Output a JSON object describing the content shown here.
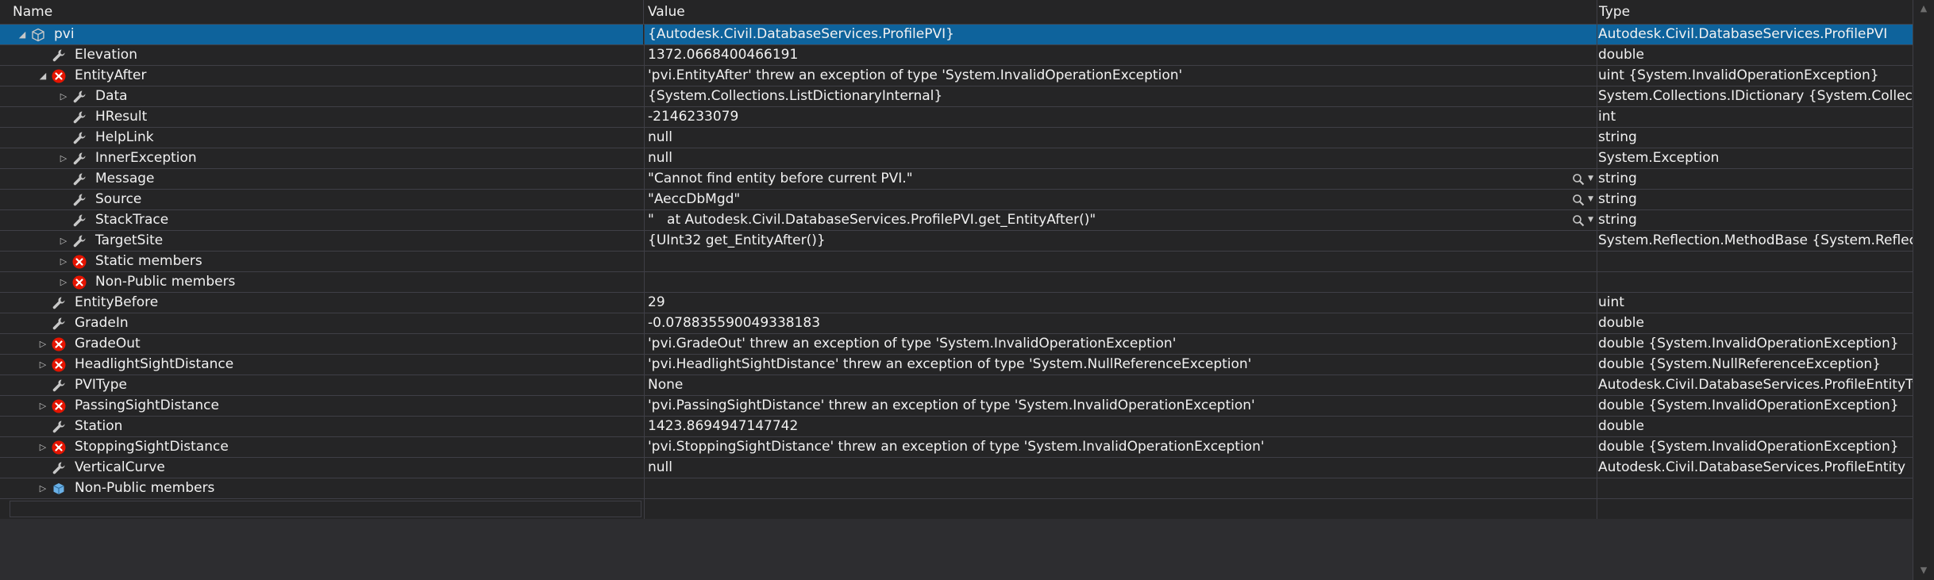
{
  "columns": {
    "name": "Name",
    "value": "Value",
    "type": "Type"
  },
  "rows": [
    {
      "name": "pvi",
      "value": "{Autodesk.Civil.DatabaseServices.ProfilePVI}",
      "type": "Autodesk.Civil.DatabaseServices.ProfilePVI",
      "icon": "object",
      "indent": 0,
      "expander": "expanded",
      "selected": true
    },
    {
      "name": "Elevation",
      "value": "1372.0668400466191",
      "type": "double",
      "icon": "wrench",
      "indent": 1,
      "expander": "none"
    },
    {
      "name": "EntityAfter",
      "value": "'pvi.EntityAfter' threw an exception of type 'System.InvalidOperationException'",
      "type": "uint {System.InvalidOperationException}",
      "icon": "error",
      "indent": 1,
      "expander": "expanded"
    },
    {
      "name": "Data",
      "value": "{System.Collections.ListDictionaryInternal}",
      "type": "System.Collections.IDictionary {System.Collectio...",
      "icon": "wrench",
      "indent": 2,
      "expander": "collapsed"
    },
    {
      "name": "HResult",
      "value": "-2146233079",
      "type": "int",
      "icon": "wrench",
      "indent": 2,
      "expander": "none"
    },
    {
      "name": "HelpLink",
      "value": "null",
      "type": "string",
      "icon": "wrench",
      "indent": 2,
      "expander": "none"
    },
    {
      "name": "InnerException",
      "value": "null",
      "type": "System.Exception",
      "icon": "wrench",
      "indent": 2,
      "expander": "collapsed"
    },
    {
      "name": "Message",
      "value": "\"Cannot find entity before current PVI.\"",
      "type": "string",
      "icon": "wrench",
      "indent": 2,
      "expander": "none",
      "viewer": true
    },
    {
      "name": "Source",
      "value": "\"AeccDbMgd\"",
      "type": "string",
      "icon": "wrench",
      "indent": 2,
      "expander": "none",
      "viewer": true
    },
    {
      "name": "StackTrace",
      "value": "\"   at Autodesk.Civil.DatabaseServices.ProfilePVI.get_EntityAfter()\"",
      "type": "string",
      "icon": "wrench",
      "indent": 2,
      "expander": "none",
      "viewer": true
    },
    {
      "name": "TargetSite",
      "value": "{UInt32 get_EntityAfter()}",
      "type": "System.Reflection.MethodBase {System.Reflectio...",
      "icon": "wrench",
      "indent": 2,
      "expander": "collapsed"
    },
    {
      "name": "Static members",
      "value": "",
      "type": "",
      "icon": "error",
      "indent": 2,
      "expander": "collapsed"
    },
    {
      "name": "Non-Public members",
      "value": "",
      "type": "",
      "icon": "error",
      "indent": 2,
      "expander": "collapsed"
    },
    {
      "name": "EntityBefore",
      "value": "29",
      "type": "uint",
      "icon": "wrench",
      "indent": 1,
      "expander": "none"
    },
    {
      "name": "GradeIn",
      "value": "-0.078835590049338183",
      "type": "double",
      "icon": "wrench",
      "indent": 1,
      "expander": "none"
    },
    {
      "name": "GradeOut",
      "value": "'pvi.GradeOut' threw an exception of type 'System.InvalidOperationException'",
      "type": "double {System.InvalidOperationException}",
      "icon": "error",
      "indent": 1,
      "expander": "collapsed"
    },
    {
      "name": "HeadlightSightDistance",
      "value": "'pvi.HeadlightSightDistance' threw an exception of type 'System.NullReferenceException'",
      "type": "double {System.NullReferenceException}",
      "icon": "error",
      "indent": 1,
      "expander": "collapsed"
    },
    {
      "name": "PVIType",
      "value": "None",
      "type": "Autodesk.Civil.DatabaseServices.ProfileEntityType",
      "icon": "wrench",
      "indent": 1,
      "expander": "none"
    },
    {
      "name": "PassingSightDistance",
      "value": "'pvi.PassingSightDistance' threw an exception of type 'System.InvalidOperationException'",
      "type": "double {System.InvalidOperationException}",
      "icon": "error",
      "indent": 1,
      "expander": "collapsed"
    },
    {
      "name": "Station",
      "value": "1423.8694947147742",
      "type": "double",
      "icon": "wrench",
      "indent": 1,
      "expander": "none"
    },
    {
      "name": "StoppingSightDistance",
      "value": "'pvi.StoppingSightDistance' threw an exception of type 'System.InvalidOperationException'",
      "type": "double {System.InvalidOperationException}",
      "icon": "error",
      "indent": 1,
      "expander": "collapsed"
    },
    {
      "name": "VerticalCurve",
      "value": "null",
      "type": "Autodesk.Civil.DatabaseServices.ProfileEntity",
      "icon": "wrench",
      "indent": 1,
      "expander": "none"
    },
    {
      "name": "Non-Public members",
      "value": "",
      "type": "",
      "icon": "members",
      "indent": 1,
      "expander": "collapsed"
    },
    {
      "name": "",
      "value": "",
      "type": "",
      "icon": "none",
      "indent": 0,
      "expander": "none",
      "edit": true
    }
  ],
  "colors": {
    "selection": "#0e639c",
    "error": "#e51400",
    "grid": "#3f3f46",
    "background": "#252526"
  },
  "icons": {
    "expanded": "expanded-arrow-icon",
    "collapsed": "collapsed-arrow-icon",
    "viewer": "magnifier-icon",
    "dropdown": "dropdown-icon"
  }
}
